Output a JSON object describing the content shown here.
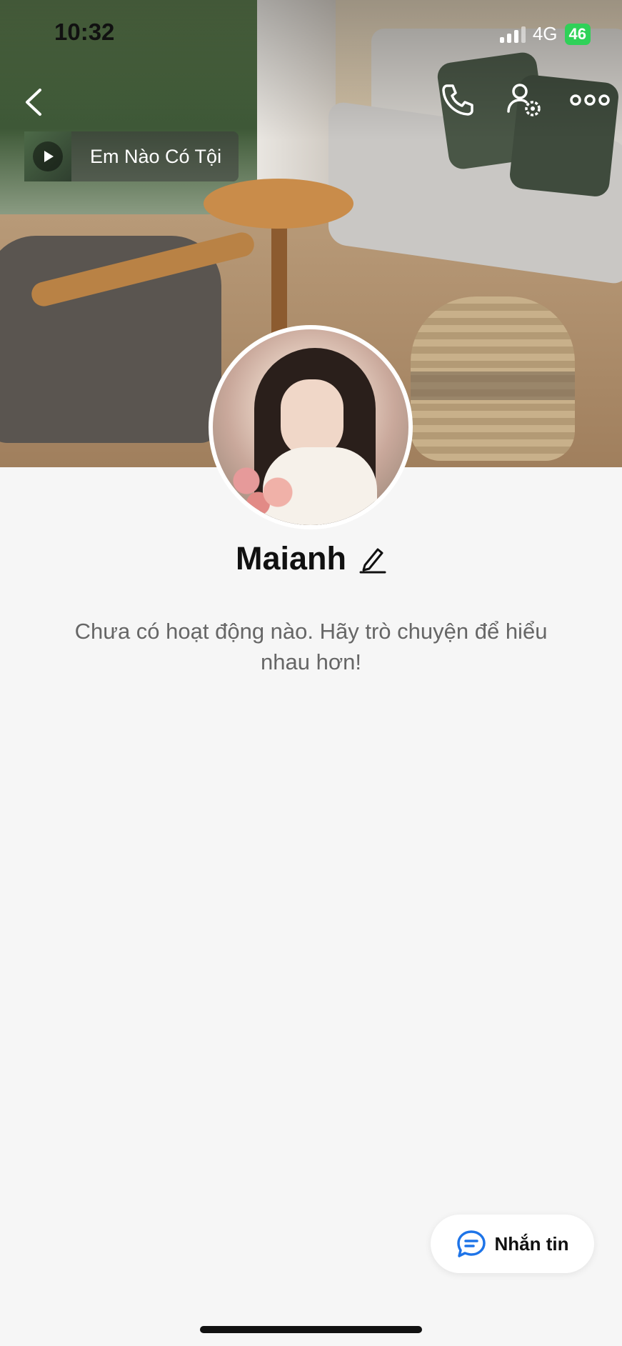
{
  "status_bar": {
    "time": "10:32",
    "network": "4G",
    "battery": "46"
  },
  "music": {
    "title": "Em Nào Có Tội"
  },
  "profile": {
    "name": "Maianh",
    "empty_message": "Chưa có hoạt động nào. Hãy trò chuyện để hiểu nhau hơn!"
  },
  "actions": {
    "message_label": "Nhắn tin"
  },
  "colors": {
    "accent": "#1e74e8",
    "battery": "#2fd158",
    "background": "#f6f6f6"
  },
  "icons": [
    "back-icon",
    "call-icon",
    "profile-settings-icon",
    "more-icon",
    "play-icon",
    "edit-icon",
    "message-icon"
  ]
}
